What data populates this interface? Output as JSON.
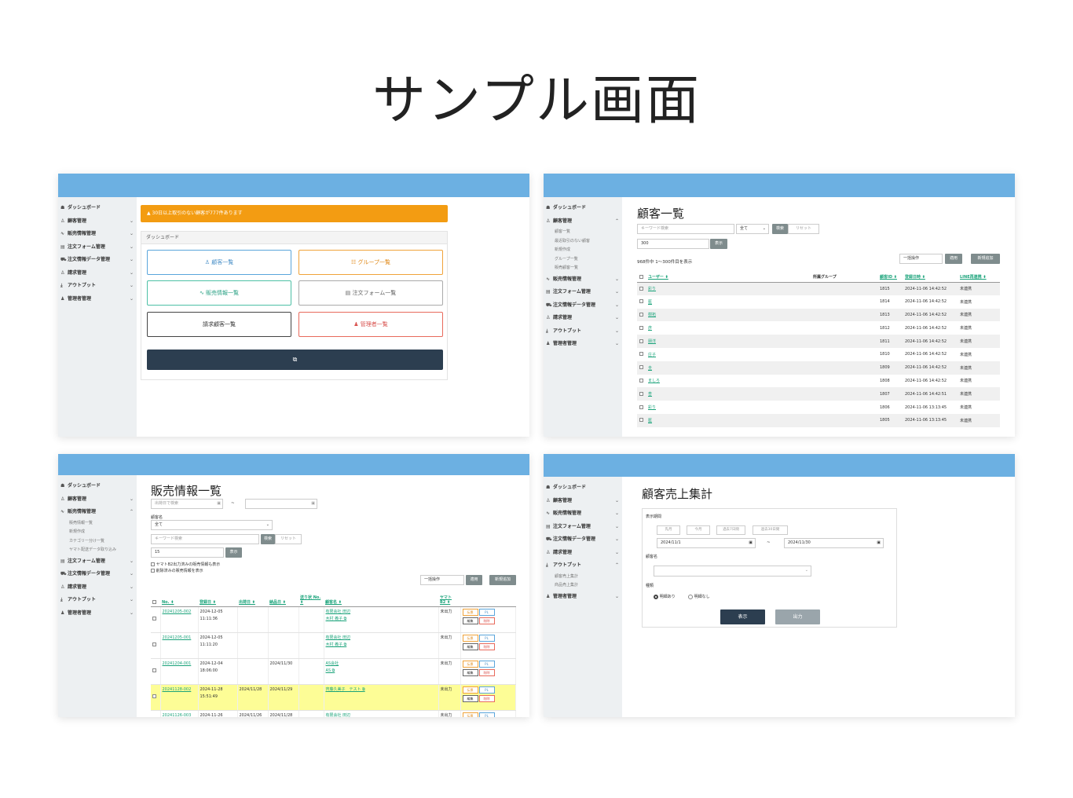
{
  "title": "サンプル画面",
  "sidebar_main": [
    {
      "label": "ダッシュボード",
      "icon": "home-icon",
      "chev": ""
    },
    {
      "label": "顧客管理",
      "icon": "user-icon",
      "chev": "⌄"
    },
    {
      "label": "販売情報管理",
      "icon": "chart-icon",
      "chev": "⌄"
    },
    {
      "label": "注文フォーム管理",
      "icon": "form-icon",
      "chev": "⌄"
    },
    {
      "label": "注文情報データ管理",
      "icon": "cart-icon",
      "chev": "⌄"
    },
    {
      "label": "請求管理",
      "icon": "user-icon",
      "chev": "⌄"
    },
    {
      "label": "アウトプット",
      "icon": "download-icon",
      "chev": "⌄"
    },
    {
      "label": "管理者管理",
      "icon": "admin-icon",
      "chev": "⌄"
    }
  ],
  "p1": {
    "alert": "▲ 30日以上取引のない顧客が777件あります",
    "card_header": "ダッシュボード",
    "buttons": [
      "♙ 顧客一覧",
      "☷ グループ一覧",
      "∿ 販売情報一覧",
      "▤ 注文フォーム一覧",
      "請求顧客一覧",
      "♟ 管理者一覧"
    ],
    "dark_button": "⧉"
  },
  "p2": {
    "heading": "顧客一覧",
    "sub_items": [
      "顧客一覧",
      "最近取引のない顧客",
      "新規作成",
      "グループ一覧",
      "販売顧客一覧"
    ],
    "keyword_placeholder": "キーワード検索",
    "select_value": "全て",
    "search_btn": "検索",
    "reset_btn": "リセット",
    "per_page": "300",
    "show_btn": "表示",
    "count_text": "968件中 1～300件目を表示",
    "bulk_placeholder": "一括操作",
    "apply_btn": "適用",
    "new_btn": "新規追加",
    "headers": [
      "ユーザー ⬍",
      "所属グループ",
      "顧客ID ⬍",
      "登録日時 ⬍",
      "LINE再連携 ⬍"
    ],
    "rows": [
      {
        "user": "彩り",
        "id": "1815",
        "date": "2024-11-06 14:42:52",
        "line": "未連携"
      },
      {
        "user": "藍",
        "id": "1814",
        "date": "2024-11-06 14:42:52",
        "line": "未連携"
      },
      {
        "user": "樹拓",
        "id": "1813",
        "date": "2024-11-06 14:42:52",
        "line": "未連携"
      },
      {
        "user": "彦",
        "id": "1812",
        "date": "2024-11-06 14:42:52",
        "line": "未連携"
      },
      {
        "user": "朋洋",
        "id": "1811",
        "date": "2024-11-06 14:42:52",
        "line": "未連携"
      },
      {
        "user": "庄子",
        "id": "1810",
        "date": "2024-11-06 14:42:52",
        "line": "未連携"
      },
      {
        "user": "圭",
        "id": "1809",
        "date": "2024-11-06 14:42:52",
        "line": "未連携"
      },
      {
        "user": "ましろ",
        "id": "1808",
        "date": "2024-11-06 14:42:52",
        "line": "未連携"
      },
      {
        "user": "杏",
        "id": "1807",
        "date": "2024-11-06 14:42:51",
        "line": "未連携"
      },
      {
        "user": "彩り",
        "id": "1806",
        "date": "2024-11-06 13:13:45",
        "line": "未連携"
      },
      {
        "user": "藍",
        "id": "1805",
        "date": "2024-11-06 13:13:45",
        "line": "未連携"
      }
    ]
  },
  "p3": {
    "heading": "販売情報一覧",
    "sub_items": [
      "販売情報一覧",
      "新規作成",
      "カテゴリー分け一覧",
      "ヤマト配送データ取り込み"
    ],
    "date_placeholder": "出荷日で検索",
    "tilde": "~",
    "customer_label": "顧客名",
    "select_value": "全て",
    "keyword_placeholder": "キーワード検索",
    "search_btn": "検索",
    "reset_btn": "リセット",
    "per_page": "15",
    "show_btn": "表示",
    "check1": "ヤマトB2出力済みの販売情報も表示",
    "check2": "削除済みの販売情報を表示",
    "bulk_placeholder": "一括操作",
    "apply_btn": "適用",
    "new_btn": "新規追加",
    "headers": [
      "No. ⬍",
      "登録日 ⬍",
      "出荷日 ⬍",
      "納品日 ⬍",
      "送り状 No. ⬍",
      "顧客名 ⬍",
      "ヤマト B2 ⬍"
    ],
    "tag_labels": [
      "伝票",
      "PL",
      "編集",
      "削除"
    ],
    "rows": [
      {
        "no": "20241205-002",
        "reg1": "2024-12-05",
        "reg2": "11:11:36",
        "ship": "",
        "deliv": "",
        "cust1": "有限会社 田辺",
        "cust2": "木村 義子 ⧉",
        "b2": "未出力",
        "hl": false
      },
      {
        "no": "20241205-001",
        "reg1": "2024-12-05",
        "reg2": "11:11:20",
        "ship": "",
        "deliv": "",
        "cust1": "有限会社 田辺",
        "cust2": "木村 義子 ⧉",
        "b2": "未出力",
        "hl": false
      },
      {
        "no": "20241204-001",
        "reg1": "2024-12-04",
        "reg2": "18:06:00",
        "ship": "",
        "deliv": "2024/11/30",
        "cust1": "AS会社",
        "cust2": "AS ⧉",
        "b2": "未出力",
        "hl": false
      },
      {
        "no": "20241128-002",
        "reg1": "2024-11-28",
        "reg2": "15:51:49",
        "ship": "2024/11/28",
        "deliv": "2024/11/29",
        "cust1": "齊藤久美子　テスト ⧉",
        "cust2": "",
        "b2": "未出力",
        "hl": true
      },
      {
        "no": "20241126-003",
        "reg1": "2024-11-26",
        "reg2": "",
        "ship": "2024/11/26",
        "deliv": "2024/11/28",
        "cust1": "有限会社 田辺",
        "cust2": "",
        "b2": "未出力",
        "hl": false
      }
    ]
  },
  "p4": {
    "heading": "顧客売上集計",
    "sub_items": [
      "顧客売上集計",
      "商品売上集計"
    ],
    "period_label": "表示期間",
    "period_btns": [
      "先月",
      "今月",
      "過去7日間",
      "過去30日間"
    ],
    "date_from": "2024/11/1",
    "date_to": "2024/11/30",
    "tilde": "~",
    "customer_label": "顧客名",
    "type_label": "種類",
    "radio1": "明細あり",
    "radio2": "明細なし",
    "show_btn": "表示",
    "output_btn": "出力"
  }
}
